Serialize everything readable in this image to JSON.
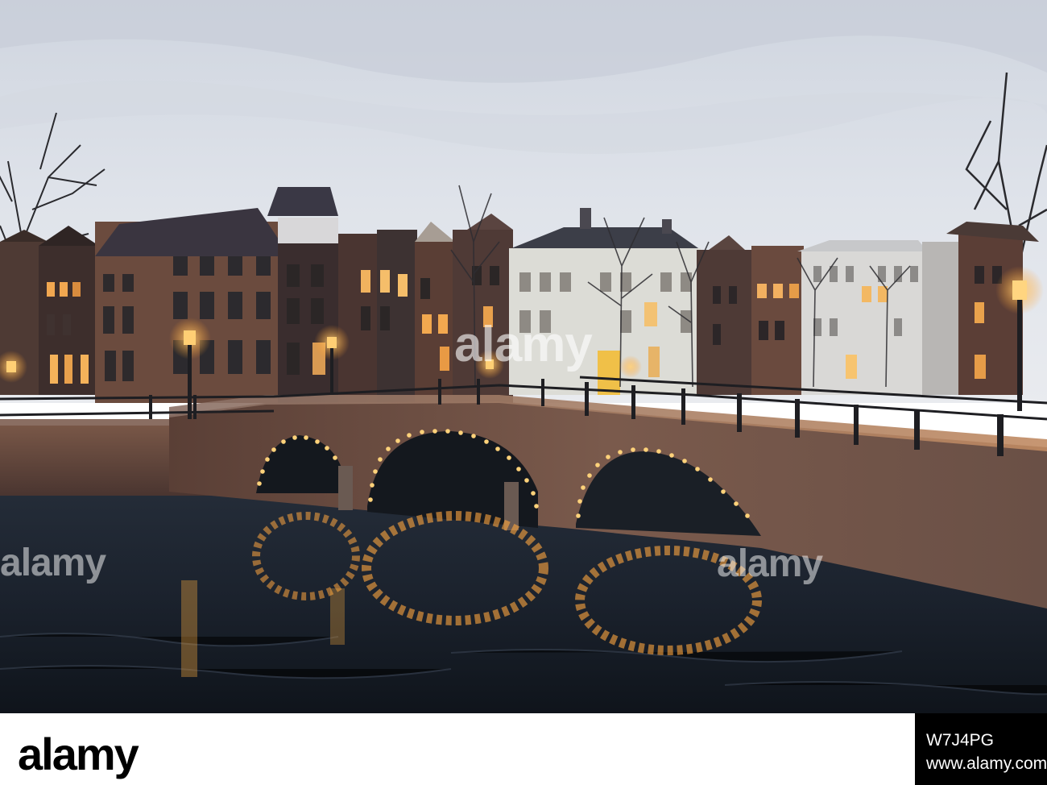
{
  "watermark": {
    "brand": "alamy",
    "color": "#ffffff"
  },
  "footer": {
    "logo": "alamy",
    "image_id": "W7J4PG",
    "url": "www.alamy.com",
    "panel_color": "#000000"
  },
  "scene": {
    "description_colors": {
      "sky": "#d8dde6",
      "water": "#1e2530",
      "brick": "#6a4a3c",
      "lights": "#ffb648"
    }
  }
}
